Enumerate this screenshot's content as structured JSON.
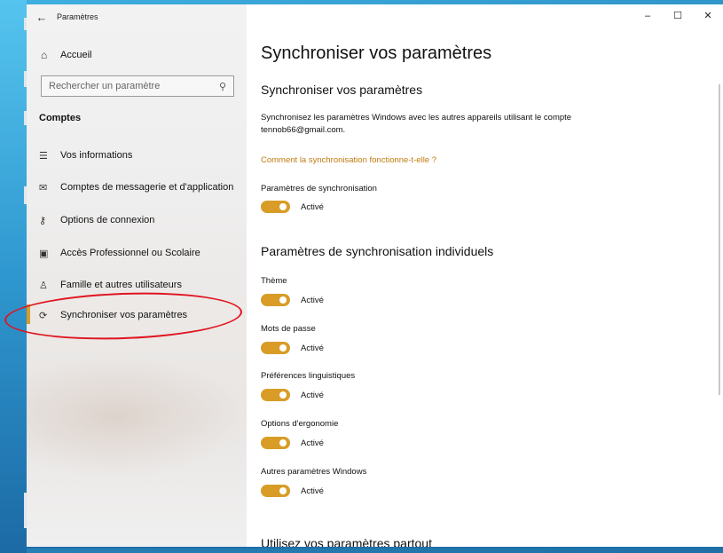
{
  "window": {
    "app_title": "Paramètres",
    "controls": {
      "minimize": "–",
      "maximize": "☐",
      "close": "✕"
    }
  },
  "sidebar": {
    "home_label": "Accueil",
    "search_placeholder": "Rechercher un paramètre",
    "section": "Comptes",
    "items": [
      {
        "label": "Vos informations",
        "icon": "person-card-icon"
      },
      {
        "label": "Comptes de messagerie et d'application",
        "icon": "mail-icon"
      },
      {
        "label": "Options de connexion",
        "icon": "key-icon"
      },
      {
        "label": "Accès Professionnel ou Scolaire",
        "icon": "briefcase-icon"
      },
      {
        "label": "Famille et autres utilisateurs",
        "icon": "person-add-icon"
      },
      {
        "label": "Synchroniser vos paramètres",
        "icon": "sync-icon"
      }
    ],
    "active_index": 5
  },
  "main": {
    "page_title": "Synchroniser vos paramètres",
    "section_title": "Synchroniser vos paramètres",
    "description": "Synchronisez les paramètres Windows avec les autres appareils utilisant le compte tennob66@gmail.com.",
    "help_link": "Comment la synchronisation fonctionne-t-elle ?",
    "sync_settings": {
      "label": "Paramètres de synchronisation",
      "state": "Activé"
    },
    "individual_title": "Paramètres de synchronisation individuels",
    "individual": [
      {
        "label": "Thème",
        "state": "Activé"
      },
      {
        "label": "Mots de passe",
        "state": "Activé"
      },
      {
        "label": "Préférences linguistiques",
        "state": "Activé"
      },
      {
        "label": "Options d'ergonomie",
        "state": "Activé"
      },
      {
        "label": "Autres paramètres Windows",
        "state": "Activé"
      }
    ],
    "bottom_title": "Utilisez vos paramètres partout"
  },
  "colors": {
    "accent": "#d89c27",
    "link": "#c17b10",
    "annotation": "#e0141f",
    "desktop": "#2d8fc4"
  }
}
